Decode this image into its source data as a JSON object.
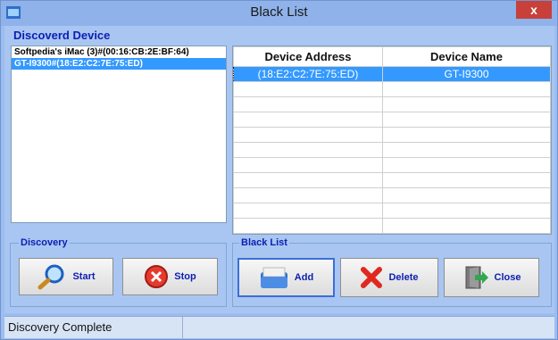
{
  "window": {
    "title": "Black List",
    "close_glyph": "x"
  },
  "discovered": {
    "label": "Discoverd Device",
    "devices": [
      "Softpedia's iMac (3)#(00:16:CB:2E:BF:64)",
      "GT-I9300#(18:E2:C2:7E:75:ED)"
    ],
    "selected_index": 1
  },
  "table": {
    "headers": [
      "Device Address",
      "Device Name"
    ],
    "rows": [
      [
        "(18:E2:C2:7E:75:ED)",
        "GT-I9300"
      ]
    ]
  },
  "discovery_group": {
    "label": "Discovery",
    "start_label": "Start",
    "stop_label": "Stop"
  },
  "blacklist_group": {
    "label": "Black List",
    "add_label": "Add",
    "delete_label": "Delete",
    "close_label": "Close"
  },
  "status": {
    "text": "Discovery Complete"
  },
  "colors": {
    "accent": "#0b1fb3",
    "selection": "#3399ff",
    "window_bg": "#9dbdf0"
  }
}
